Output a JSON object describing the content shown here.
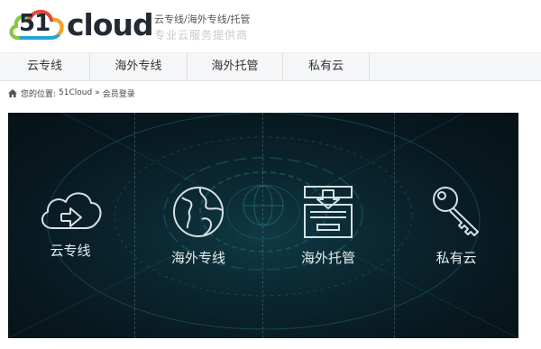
{
  "logo": {
    "number": "51",
    "word": "cloud",
    "slogan_line1": "云专线/海外专线/托管",
    "slogan_line2": "专业云服务提供商"
  },
  "nav": {
    "items": [
      {
        "label": "云专线"
      },
      {
        "label": "海外专线"
      },
      {
        "label": "海外托管"
      },
      {
        "label": "私有云"
      }
    ]
  },
  "breadcrumb": {
    "prefix": "您的位置:",
    "home": "51Cloud",
    "separator": "»",
    "current": "会员登录"
  },
  "banner": {
    "services": [
      {
        "label": "云专线",
        "icon": "cloud-upload-icon"
      },
      {
        "label": "海外专线",
        "icon": "globe-icon"
      },
      {
        "label": "海外托管",
        "icon": "server-tray-icon"
      },
      {
        "label": "私有云",
        "icon": "key-icon"
      }
    ]
  }
}
